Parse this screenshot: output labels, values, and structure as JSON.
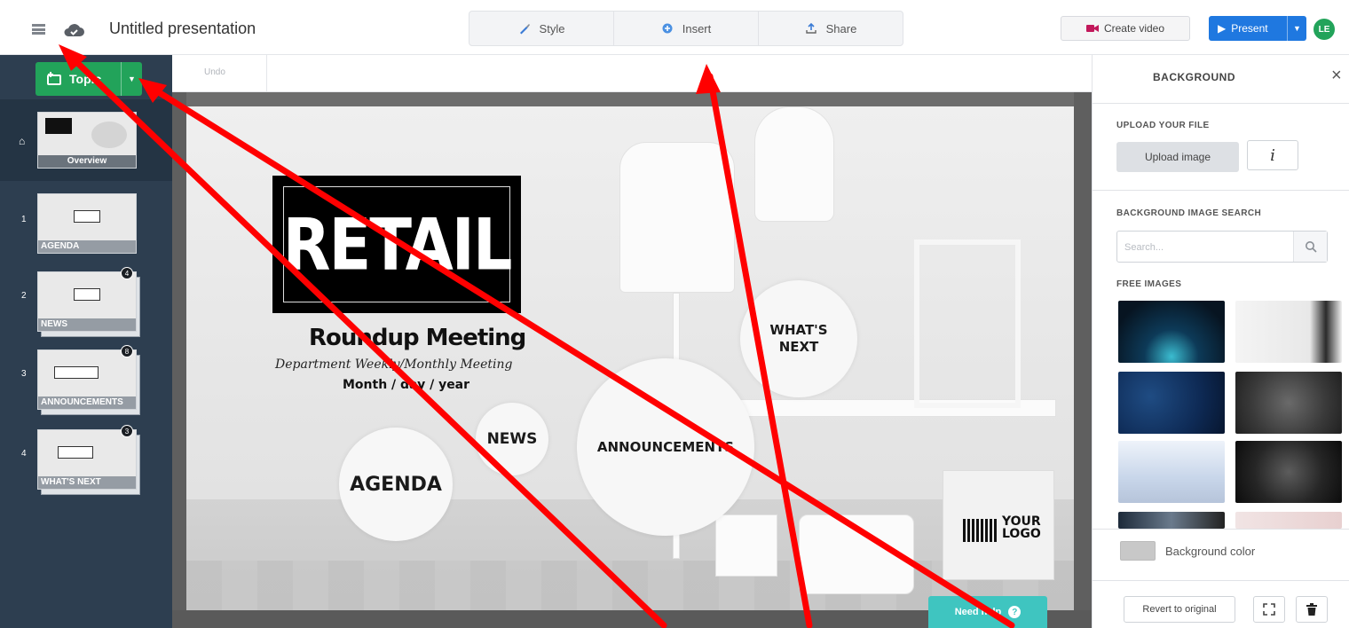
{
  "header": {
    "title": "Untitled presentation",
    "tabs": [
      {
        "label": "Style",
        "icon": "paintbrush-icon"
      },
      {
        "label": "Insert",
        "icon": "insert-shape-icon"
      },
      {
        "label": "Share",
        "icon": "share-upload-icon"
      }
    ],
    "create_video_label": "Create video",
    "present_label": "Present",
    "avatar_initials": "LE"
  },
  "sidebar": {
    "topic_label": "Topic",
    "undo_label": "Undo",
    "overview_label": "Overview",
    "slides": [
      {
        "number": "1",
        "label": "AGENDA",
        "badge": ""
      },
      {
        "number": "2",
        "label": "NEWS",
        "badge": "4"
      },
      {
        "number": "3",
        "label": "ANNOUNCEMENTS",
        "badge": "8"
      },
      {
        "number": "4",
        "label": "WHAT'S NEXT",
        "badge": "3"
      }
    ]
  },
  "slide": {
    "brand": "RETAIL",
    "heading": "Roundup Meeting",
    "subheading": "Department Weekly/Monthly Meeting",
    "date": "Month / day / year",
    "topics": {
      "agenda": "AGENDA",
      "news": "NEWS",
      "announcements": "ANNOUNCEMENTS",
      "next_line1": "WHAT'S",
      "next_line2": "NEXT"
    },
    "logo_line1": "YOUR",
    "logo_line2": "LOGO"
  },
  "help": {
    "label": "Need help"
  },
  "panel": {
    "title": "BACKGROUND",
    "upload_section": "UPLOAD YOUR FILE",
    "upload_button": "Upload image",
    "info_glyph": "i",
    "search_section": "BACKGROUND IMAGE SEARCH",
    "search_placeholder": "Search...",
    "free_images_section": "FREE IMAGES",
    "bg_color_label": "Background color",
    "revert_label": "Revert to original"
  },
  "colors": {
    "accent_green": "#22a35a",
    "present_blue": "#1f78e0",
    "sidebar_bg": "#2d3e50",
    "help_teal": "#3fc5c0",
    "annotation_red": "#ff0000"
  }
}
